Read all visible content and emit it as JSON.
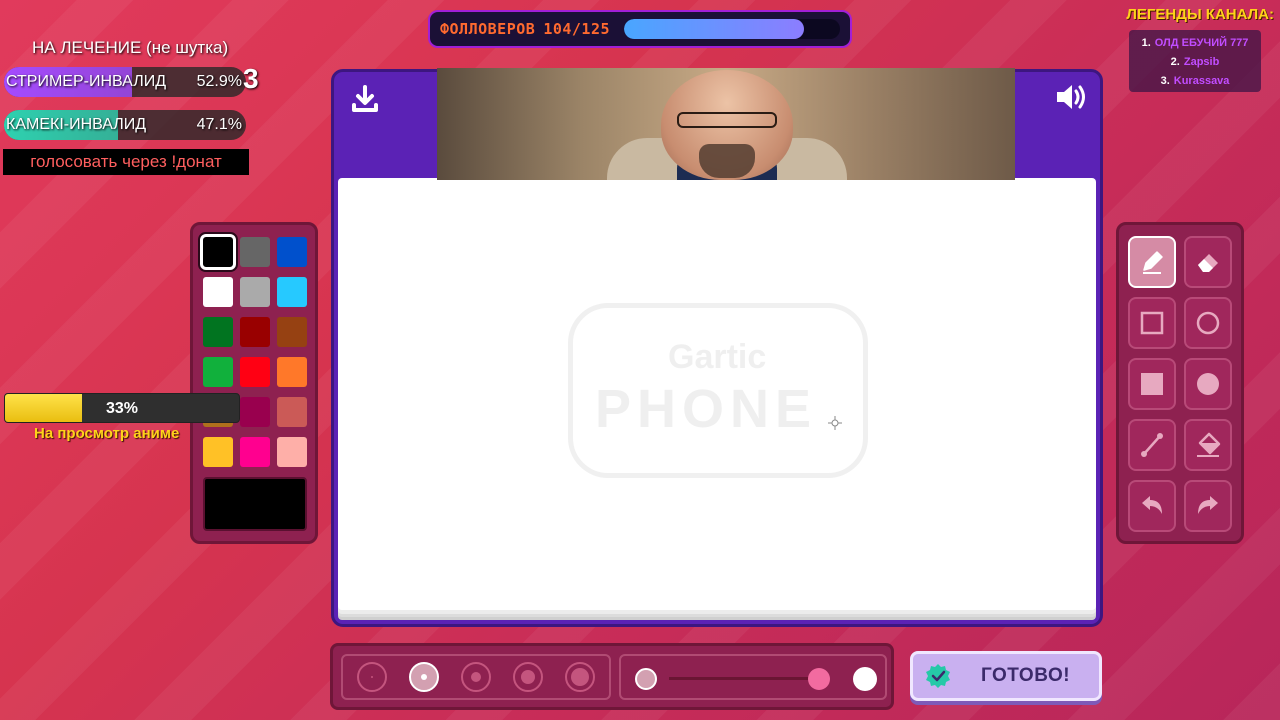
{
  "followers": {
    "label": "ФОЛЛОВЕРОВ",
    "count": "104/125",
    "progress": 0.832
  },
  "legends": {
    "title": "ЛЕГЕНДЫ КАНАЛА:",
    "entries": [
      {
        "rank": "1.",
        "name": "ОЛД ЕБУЧИЙ 777"
      },
      {
        "rank": "2.",
        "name": "Zapsib"
      },
      {
        "rank": "3.",
        "name": "Kurassava"
      }
    ]
  },
  "poll": {
    "title": "НА ЛЕЧЕНИЕ (не шутка)",
    "options": [
      {
        "name": "СТРИМЕР-ИНВАЛИД",
        "percent": "52.9%",
        "value": 0.529,
        "color": "#a54bff"
      },
      {
        "name": "КАМЕКІ-ИНВАЛИД",
        "percent": "47.1%",
        "value": 0.471,
        "color": "#2ed1b0"
      }
    ],
    "sticker": "3",
    "cta": "голосовать через !донат"
  },
  "goal": {
    "percent": "33%",
    "value": 0.33,
    "label": "На просмотр аниме"
  },
  "palette": {
    "colors": [
      "#000000",
      "#666666",
      "#0050cc",
      "#ffffff",
      "#aaaaaa",
      "#26c9ff",
      "#017420",
      "#990000",
      "#964112",
      "#11b03c",
      "#ff0013",
      "#ff7829",
      "#b0701c",
      "#99004e",
      "#cb5a57",
      "#ffc126",
      "#ff008f",
      "#feafa8"
    ],
    "selected_index": 0,
    "current_color": "#000000"
  },
  "board": {
    "watermark_gartic": "Gartic",
    "watermark_phone": "PHONE"
  },
  "tools": [
    "pencil-icon",
    "eraser-icon",
    "square-outline-icon",
    "circle-outline-icon",
    "square-filled-icon",
    "circle-filled-icon",
    "line-icon",
    "bucket-icon",
    "undo-icon",
    "redo-icon"
  ],
  "brush_sizes": {
    "count": 5,
    "selected_index": 1
  },
  "opacity": {
    "value": 1.0
  },
  "done": {
    "label": "ГОТОВО!"
  }
}
